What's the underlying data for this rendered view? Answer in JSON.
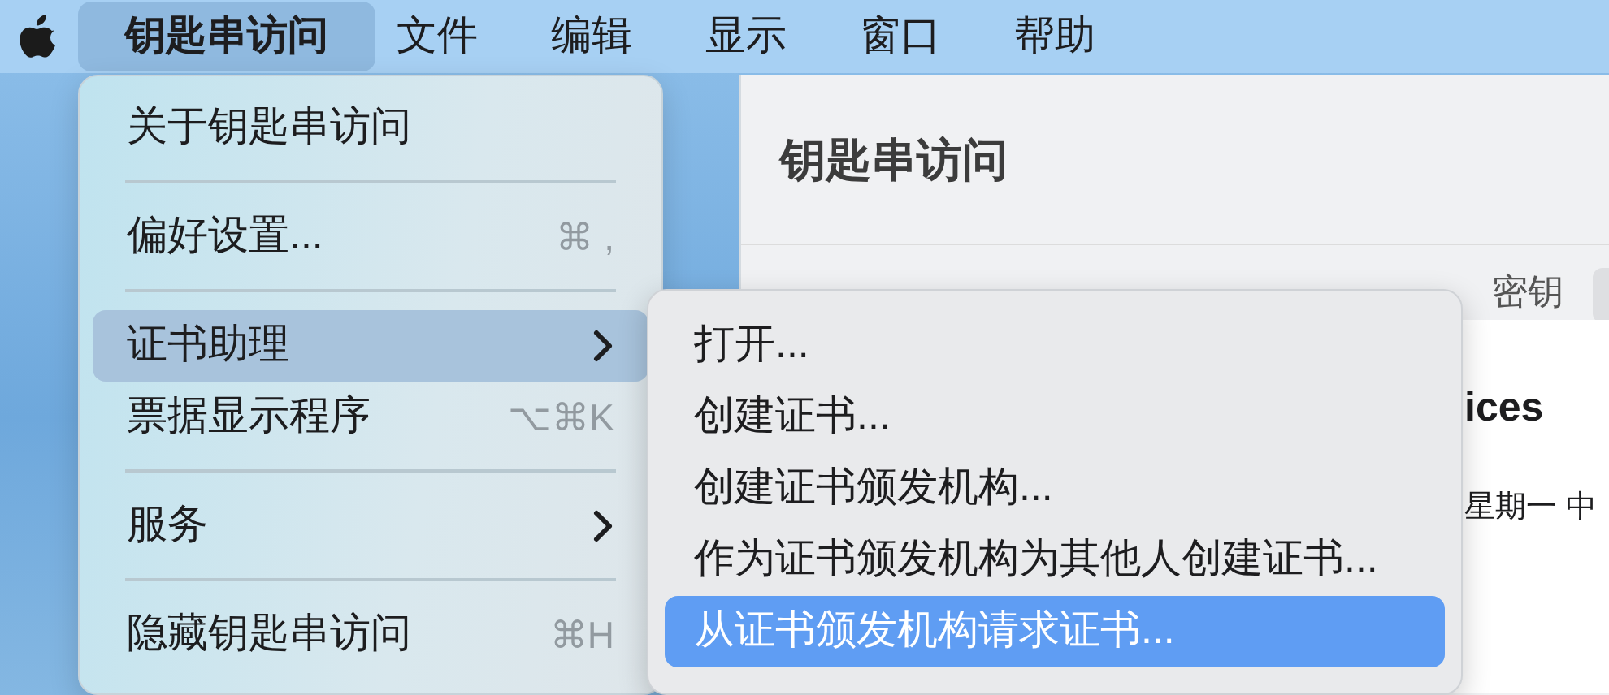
{
  "menu_bar": {
    "items": [
      {
        "kind": "app",
        "label": "钥匙串访问",
        "selected": true
      },
      {
        "kind": "menu",
        "label": "文件",
        "selected": false
      },
      {
        "kind": "menu",
        "label": "编辑",
        "selected": false
      },
      {
        "kind": "menu",
        "label": "显示",
        "selected": false
      },
      {
        "kind": "menu",
        "label": "窗口",
        "selected": false
      },
      {
        "kind": "menu",
        "label": "帮助",
        "selected": false
      }
    ]
  },
  "app_menu": {
    "items": [
      {
        "kind": "item",
        "label": "关于钥匙串访问",
        "selected": false
      },
      {
        "kind": "separator"
      },
      {
        "kind": "item",
        "label": "偏好设置...",
        "shortcut": "⌘ ,",
        "selected": false
      },
      {
        "kind": "separator"
      },
      {
        "kind": "submenu",
        "label": "证书助理",
        "selected": true
      },
      {
        "kind": "item",
        "label": "票据显示程序",
        "shortcut": "⌥⌘K",
        "selected": false
      },
      {
        "kind": "separator"
      },
      {
        "kind": "submenu",
        "label": "服务",
        "selected": false
      },
      {
        "kind": "separator"
      },
      {
        "kind": "item",
        "label": "隐藏钥匙串访问",
        "shortcut": "⌘H",
        "selected": false
      }
    ]
  },
  "submenu": {
    "items": [
      {
        "label": "打开...",
        "selected": false
      },
      {
        "label": "创建证书...",
        "selected": false
      },
      {
        "label": "创建证书颁发机构...",
        "selected": false
      },
      {
        "label": "作为证书颁发机构为其他人创建证书...",
        "selected": false
      },
      {
        "label": "从证书颁发机构请求证书...",
        "selected": true
      }
    ]
  },
  "window": {
    "title": "钥匙串访问",
    "tabs": [
      {
        "label": "密钥"
      }
    ],
    "item_title": "ices",
    "item_date": "星期一 中"
  }
}
